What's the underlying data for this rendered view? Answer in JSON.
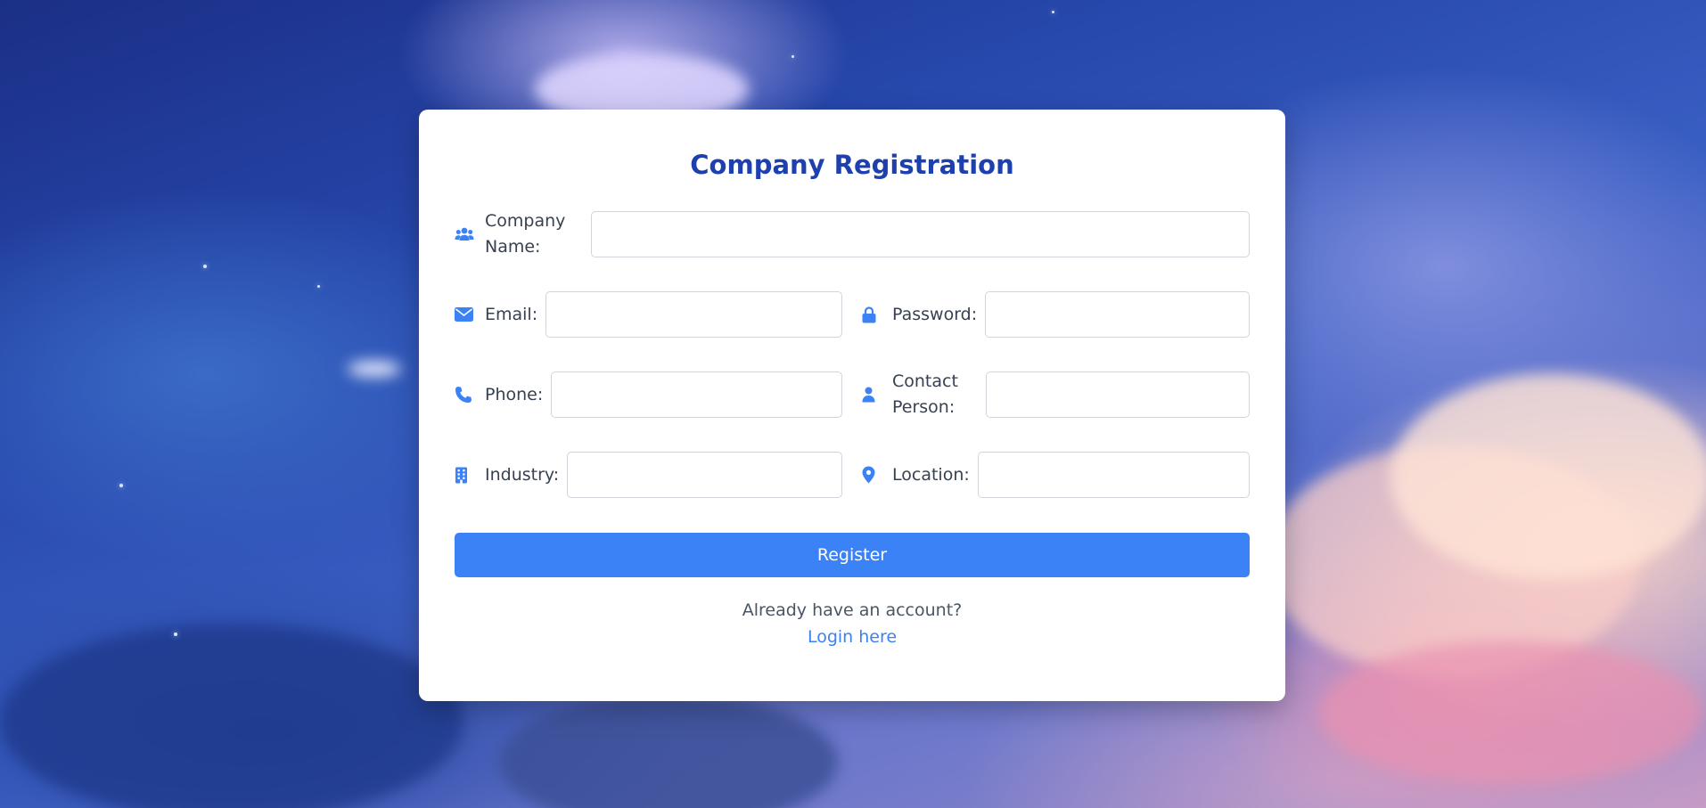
{
  "form": {
    "title": "Company Registration",
    "fields": {
      "company_name": {
        "label": "Company Name:",
        "value": "",
        "icon": "users-icon"
      },
      "email": {
        "label": "Email:",
        "value": "",
        "icon": "envelope-icon"
      },
      "password": {
        "label": "Password:",
        "value": "",
        "icon": "lock-icon"
      },
      "phone": {
        "label": "Phone:",
        "value": "",
        "icon": "phone-icon"
      },
      "contact_person": {
        "label": "Contact Person:",
        "value": "",
        "icon": "user-icon"
      },
      "industry": {
        "label": "Industry:",
        "value": "",
        "icon": "building-icon"
      },
      "location": {
        "label": "Location:",
        "value": "",
        "icon": "map-marker-icon"
      }
    },
    "register_label": "Register",
    "login_prompt": "Already have an account?",
    "login_link": "Login here"
  },
  "colors": {
    "accent": "#3b82f6",
    "title": "#1e40af",
    "label": "#374151"
  }
}
